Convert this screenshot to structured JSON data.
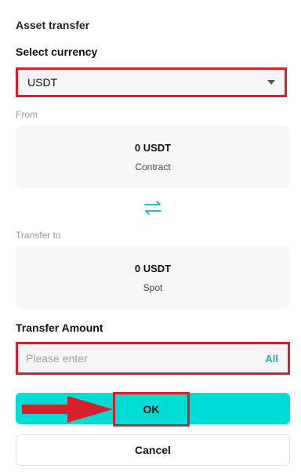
{
  "header": {
    "title": "Asset transfer"
  },
  "currency": {
    "label": "Select currency",
    "selected": "USDT"
  },
  "from": {
    "label": "From",
    "amount": "0 USDT",
    "account": "Contract"
  },
  "to": {
    "label": "Transfer to",
    "amount": "0 USDT",
    "account": "Spot"
  },
  "transfer_amount": {
    "label": "Transfer Amount",
    "placeholder": "Please enter",
    "all_label": "All"
  },
  "actions": {
    "ok_label": "OK",
    "cancel_label": "Cancel"
  },
  "icons": {
    "swap": "swap-arrows-icon",
    "dropdown": "caret-down-icon",
    "pointer": "red-arrow-icon"
  },
  "colors": {
    "accent": "#00ddd6",
    "accent_text": "#16b3b0",
    "highlight": "#d6202e"
  }
}
